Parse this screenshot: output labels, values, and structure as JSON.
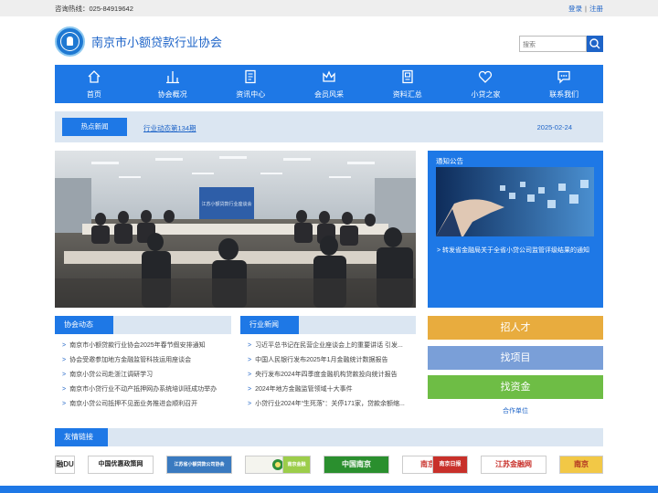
{
  "topbar": {
    "hotline": "咨询热线：025-84919642",
    "login": "登录",
    "separator": "|",
    "register": "注册"
  },
  "header": {
    "title": "南京市小额贷款行业协会",
    "search_placeholder": "搜索"
  },
  "nav": [
    {
      "label": "首页",
      "icon": "home-icon"
    },
    {
      "label": "协会概况",
      "icon": "bar-chart-icon"
    },
    {
      "label": "资讯中心",
      "icon": "document-icon"
    },
    {
      "label": "会员风采",
      "icon": "crown-icon"
    },
    {
      "label": "资料汇总",
      "icon": "folder-icon"
    },
    {
      "label": "小贷之家",
      "icon": "heart-icon"
    },
    {
      "label": "联系我们",
      "icon": "chat-icon"
    }
  ],
  "hotnews": {
    "tag": "热点新闻",
    "link": "行业动态第134期",
    "date": "2025-02-24"
  },
  "notice": {
    "title": "通知公告",
    "item": "转发省金融局关于全省小贷公司监管评级结果的通知"
  },
  "association": {
    "title": "协会动态",
    "items": [
      "南京市小额贷款行业协会2025年春节假安排通知",
      "协会受邀参加地方金融监管科技运用座谈会",
      "南京小贷公司赴浙江调研学习",
      "南京市小贷行业不动产抵押网办系统培训班成功举办",
      "南京小贷公司抵押不见面业务推进会顺利召开"
    ]
  },
  "industry": {
    "title": "行业新闻",
    "items": [
      "习近平总书记在民营企业座谈会上的重要讲话 引发...",
      "中国人民银行发布2025年1月金融统计数据报告",
      "央行发布2024年四季度金融机构贷款投向统计报告",
      "2024年地方金融监管领域十大事件",
      "小贷行业2024年“生死落”：关停171家，贷款余额缩..."
    ]
  },
  "side": {
    "talent": "招人才",
    "project": "找项目",
    "capital": "找资金",
    "partner": "合作单位"
  },
  "side_colors": {
    "talent": "#e8ac3e",
    "project": "#7a9fd8",
    "capital": "#6ebd45"
  },
  "friends": {
    "title": "友情链接"
  },
  "partners": [
    "融DU",
    "中国优惠政策网",
    "江苏省小额贷款公司协会",
    "",
    "南京金融",
    "中国南京",
    "南京金融",
    "南京日报",
    "江苏金融网",
    "南京"
  ],
  "photo": {
    "banner_text": "江苏小额贷款行业座谈会"
  },
  "colors": {
    "primary": "#1e78e6",
    "light_band": "#dbe6f2"
  }
}
